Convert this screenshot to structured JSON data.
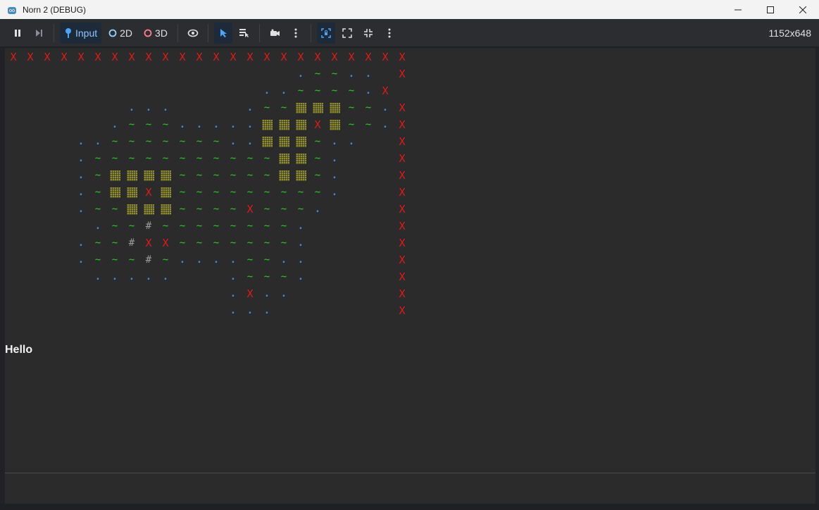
{
  "window": {
    "title": "Norn 2 (DEBUG)",
    "controls": [
      "minimize-icon",
      "maximize-icon",
      "close-icon"
    ]
  },
  "toolbar": {
    "pause_icon": "pause-icon",
    "step_icon": "step-frame-icon",
    "input_label": "Input",
    "mode_2d_label": "2D",
    "mode_3d_label": "3D",
    "resolution": "1152x648",
    "colors": {
      "accent": "#4fa3f7",
      "mode_2d": "#8fd6ff",
      "mode_3d": "#ff7f8a"
    }
  },
  "game": {
    "legend": {
      "X": "#e01b1b",
      ".": "#3b8fd9",
      "~": "#2ec92e",
      "#": "#9a9a9a",
      "B": "#8f8c3a"
    },
    "map": [
      "XXXXXXXXXXXXXXXXXXXXXXXX",
      "                 .~~.. X",
      "               ..~~~~.X",
      "       ...    .~~BBB~~.X",
      "      .~~~.....BBBXB~~.X",
      "    ..~~~~~~~..BBB~..  X",
      "    .~~~~~~~~~~~BB~.   X",
      "    .~BBBB~~~~~~BB~.   X",
      "    .~BBXB~~~~~~~~~.   X",
      "    .~~BBB~~~~X~~~.    X",
      "     .~~#~~~~~~~~.     X",
      "    .~~#XX~~~~~~~.     X",
      "    .~~~#~....~~..     X",
      "     .....   .~~~.     X",
      "             .X..      X",
      "             ...       X"
    ],
    "text": "Hello"
  }
}
